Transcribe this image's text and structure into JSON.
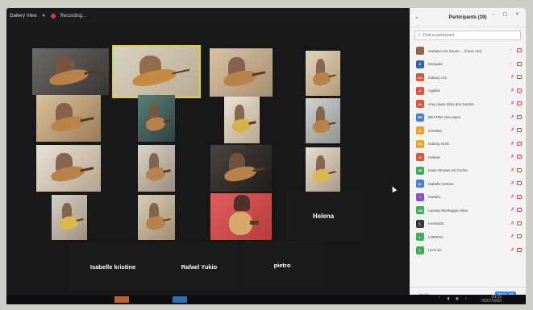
{
  "app": {
    "view_label": "Gallery View",
    "recording_label": "Recording..."
  },
  "gallery": {
    "name_tiles": [
      "Helena",
      "Isabelle kristine",
      "Rafael Yukio",
      "pietro"
    ]
  },
  "panel": {
    "title": "Participants (19)",
    "search_placeholder": "Find a participant",
    "participants": [
      {
        "initials": "",
        "name": "Gustavo De Souza ... (Host, me)",
        "color": "#8a6a4a",
        "mic": "on"
      },
      {
        "initials": "E",
        "name": "Ezequiel",
        "color": "#3a5fa8",
        "mic": "on"
      },
      {
        "initials": "GA",
        "name": "Galaxy A11",
        "color": "#e0533b",
        "mic": "off"
      },
      {
        "initials": "A",
        "name": "Agatha",
        "color": "#e0533b",
        "mic": "off"
      },
      {
        "initials": "AL",
        "name": "Ana Laura Silva dos Santos",
        "color": "#e0533b",
        "mic": "off"
      },
      {
        "initials": "BD",
        "name": "BEATRIZ dos anjos",
        "color": "#4a7bd6",
        "mic": "off"
      },
      {
        "initials": "C",
        "name": "christian",
        "color": "#f0a030",
        "mic": "off"
      },
      {
        "initials": "GA",
        "name": "Galaxy A10s",
        "color": "#f0a030",
        "mic": "off"
      },
      {
        "initials": "H",
        "name": "Helena",
        "color": "#e0533b",
        "mic": "off"
      },
      {
        "initials": "IM",
        "name": "Isaac Moraes da Cunha",
        "color": "#3fae5a",
        "mic": "off"
      },
      {
        "initials": "IK",
        "name": "Isabelle kristine",
        "color": "#4a7bd6",
        "mic": "off"
      },
      {
        "initials": "I",
        "name": "Isadora",
        "color": "#8a4ec8",
        "mic": "off"
      },
      {
        "initials": "LM",
        "name": "Larissa Monteggia Silva",
        "color": "#3fae5a",
        "mic": "off"
      },
      {
        "initials": "L",
        "name": "Leonardo",
        "color": "#3a3a3a",
        "mic": "off"
      },
      {
        "initials": "L",
        "name": "LORENA",
        "color": "#3fae5a",
        "mic": "off"
      },
      {
        "initials": "L",
        "name": "Lorenzo",
        "color": "#3fae5a",
        "mic": "off"
      }
    ],
    "invite_label": "Invite",
    "mute_all_label": "Mute All"
  },
  "taskbar": {
    "time": "20:09",
    "date": "05/07/2020"
  }
}
